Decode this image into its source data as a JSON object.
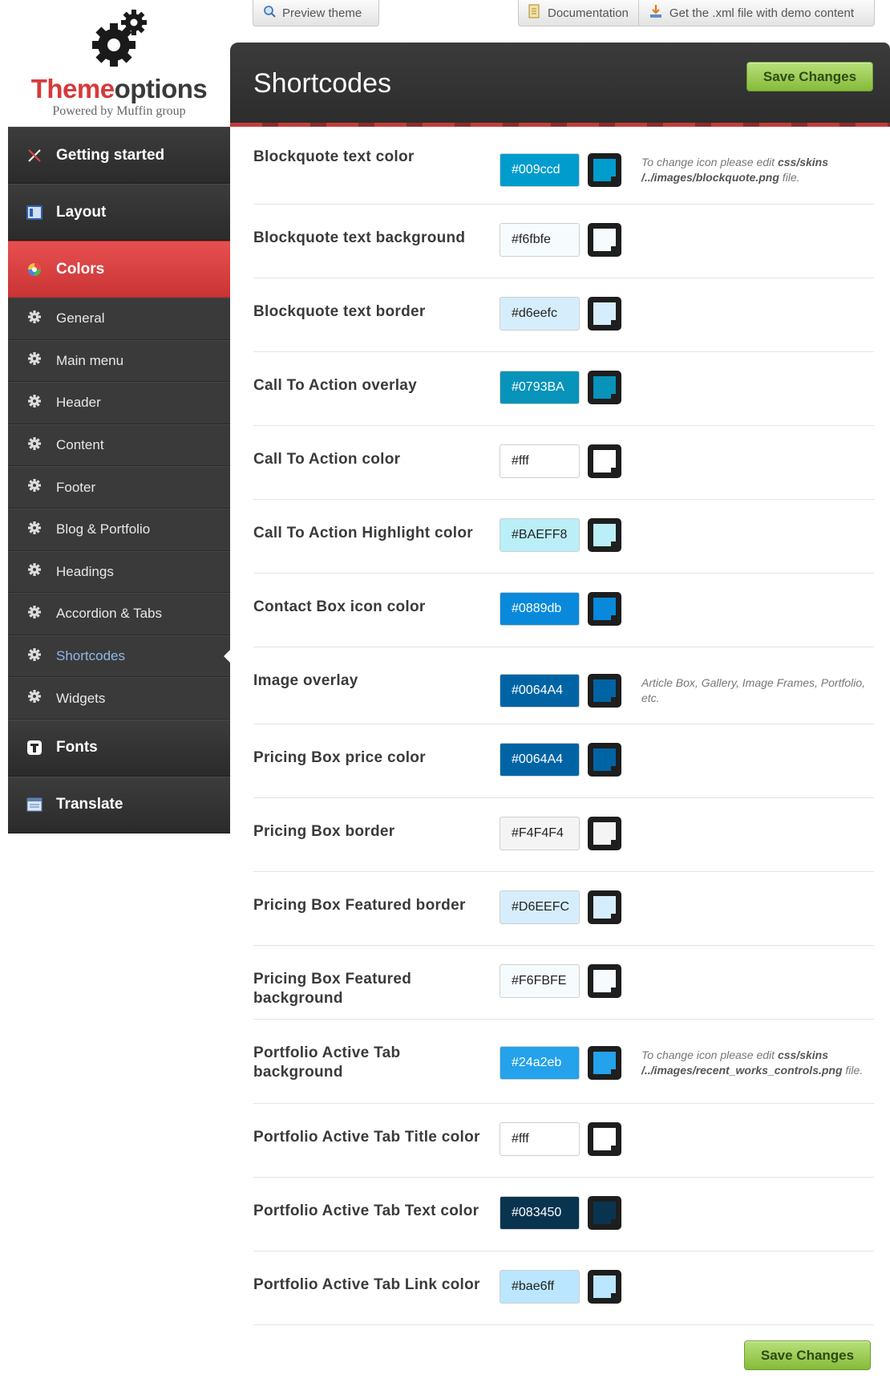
{
  "toolbar": {
    "preview_label": "Preview theme",
    "docs_label": "Documentation",
    "xml_label": "Get the .xml file with demo content"
  },
  "logo": {
    "brand_red": "Theme",
    "brand_dark": "options",
    "powered": "Powered by Muffin group"
  },
  "sidebar": {
    "items": [
      {
        "label": "Getting started",
        "kind": "main",
        "icon": "tools-icon"
      },
      {
        "label": "Layout",
        "kind": "main",
        "icon": "layout-icon"
      },
      {
        "label": "Colors",
        "kind": "main",
        "icon": "palette-icon",
        "active": true
      },
      {
        "label": "General",
        "kind": "sub",
        "icon": "gear-icon"
      },
      {
        "label": "Main menu",
        "kind": "sub",
        "icon": "gear-icon"
      },
      {
        "label": "Header",
        "kind": "sub",
        "icon": "gear-icon"
      },
      {
        "label": "Content",
        "kind": "sub",
        "icon": "gear-icon"
      },
      {
        "label": "Footer",
        "kind": "sub",
        "icon": "gear-icon"
      },
      {
        "label": "Blog & Portfolio",
        "kind": "sub",
        "icon": "gear-icon"
      },
      {
        "label": "Headings",
        "kind": "sub",
        "icon": "gear-icon"
      },
      {
        "label": "Accordion & Tabs",
        "kind": "sub",
        "icon": "gear-icon"
      },
      {
        "label": "Shortcodes",
        "kind": "sub",
        "icon": "gear-icon",
        "current": true
      },
      {
        "label": "Widgets",
        "kind": "sub",
        "icon": "gear-icon"
      },
      {
        "label": "Fonts",
        "kind": "main",
        "icon": "font-icon"
      },
      {
        "label": "Translate",
        "kind": "main",
        "icon": "translate-icon"
      }
    ]
  },
  "panel": {
    "title": "Shortcodes",
    "save_label": "Save Changes"
  },
  "colors": {
    "accent_red": "#d63a3a",
    "save_green": "#85bb3a"
  },
  "rows": [
    {
      "label": "Blockquote text color",
      "value": "#009ccd",
      "swatch": "#009ccd",
      "text_color": "#ffffff",
      "note": [
        {
          "t": "To change icon please edit "
        },
        {
          "t": "css/skins /../images/blockquote.png",
          "b": true
        },
        {
          "t": " file."
        }
      ]
    },
    {
      "label": "Blockquote text background",
      "value": "#f6fbfe",
      "swatch": "#f6fbfe",
      "text_color": "#222222"
    },
    {
      "label": "Blockquote text border",
      "value": "#d6eefc",
      "swatch": "#d6eefc",
      "text_color": "#222222"
    },
    {
      "label": "Call To Action overlay",
      "value": "#0793BA",
      "swatch": "#0793BA",
      "text_color": "#ffffff"
    },
    {
      "label": "Call To Action color",
      "value": "#fff",
      "swatch": "#ffffff",
      "text_color": "#222222"
    },
    {
      "label": "Call To Action Highlight color",
      "value": "#BAEFF8",
      "swatch": "#BAEFF8",
      "text_color": "#222222"
    },
    {
      "label": "Contact Box icon color",
      "value": "#0889db",
      "swatch": "#0889db",
      "text_color": "#ffffff"
    },
    {
      "label": "Image overlay",
      "value": "#0064A4",
      "swatch": "#0064A4",
      "text_color": "#ffffff",
      "note": [
        {
          "t": "Article Box, Gallery, Image Frames, Portfolio, etc."
        }
      ]
    },
    {
      "label": "Pricing Box price color",
      "value": "#0064A4",
      "swatch": "#0064A4",
      "text_color": "#ffffff"
    },
    {
      "label": "Pricing Box border",
      "value": "#F4F4F4",
      "swatch": "#F4F4F4",
      "text_color": "#222222"
    },
    {
      "label": "Pricing Box Featured border",
      "value": "#D6EEFC",
      "swatch": "#D6EEFC",
      "text_color": "#222222"
    },
    {
      "label": "Pricing Box Featured background",
      "value": "#F6FBFE",
      "swatch": "#F6FBFE",
      "text_color": "#222222"
    },
    {
      "label": "Portfolio Active Tab background",
      "value": "#24a2eb",
      "swatch": "#24a2eb",
      "text_color": "#ffffff",
      "note": [
        {
          "t": "To change icon please edit "
        },
        {
          "t": "css/skins /../images/recent_works_controls.png",
          "b": true
        },
        {
          "t": " file."
        }
      ]
    },
    {
      "label": "Portfolio Active Tab Title color",
      "value": "#fff",
      "swatch": "#ffffff",
      "text_color": "#222222"
    },
    {
      "label": "Portfolio Active Tab Text color",
      "value": "#083450",
      "swatch": "#083450",
      "text_color": "#ffffff"
    },
    {
      "label": "Portfolio Active Tab Link color",
      "value": "#bae6ff",
      "swatch": "#bae6ff",
      "text_color": "#222222"
    }
  ]
}
